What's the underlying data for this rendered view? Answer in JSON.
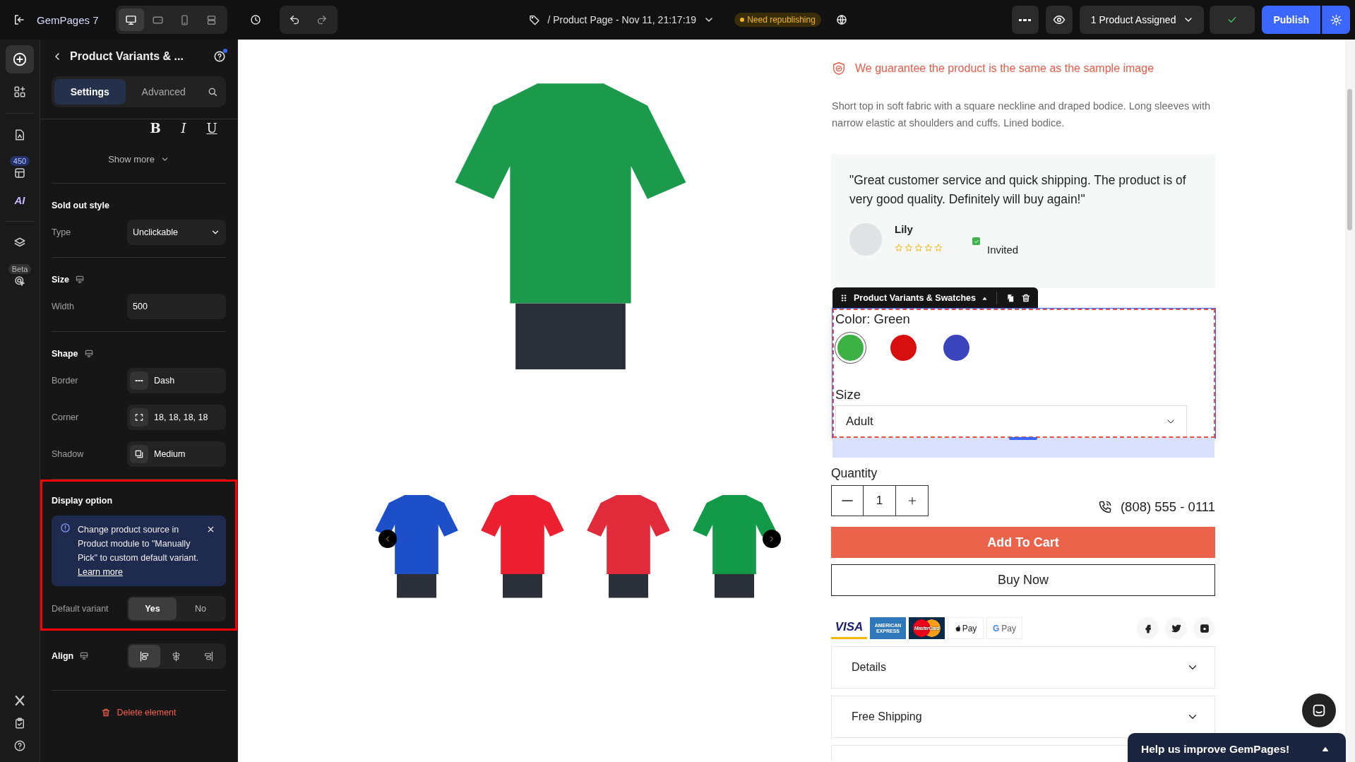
{
  "topbar": {
    "brand": "GemPages 7",
    "devices": [
      {
        "kind": "desktop",
        "selected": true
      },
      {
        "kind": "tablet",
        "selected": false
      },
      {
        "kind": "mobile",
        "selected": false
      },
      {
        "kind": "split",
        "selected": false
      }
    ],
    "page_title": "/ Product Page - Nov 11, 21:17:19",
    "status_badge": "Need republishing",
    "assigned": "1 Product Assigned",
    "publish": "Publish"
  },
  "rail": {
    "groups": [
      [
        {
          "kind": "add",
          "selected": true
        },
        {
          "kind": "elements",
          "selected": false
        }
      ],
      [
        {
          "kind": "pages",
          "selected": false
        },
        {
          "kind": "sections",
          "badge": "450",
          "selected": false
        },
        {
          "kind": "ai",
          "label": "AI",
          "selected": false
        }
      ],
      [
        {
          "kind": "layers",
          "selected": false
        },
        {
          "kind": "tracking",
          "badge": "Beta",
          "selected": false
        }
      ]
    ],
    "bottom": [
      {
        "kind": "x"
      },
      {
        "kind": "checklist"
      },
      {
        "kind": "help"
      }
    ]
  },
  "panel": {
    "title": "Product Variants & ...",
    "tabs": [
      {
        "label": "Settings",
        "selected": true
      },
      {
        "label": "Advanced",
        "selected": false
      }
    ],
    "format_buttons": [
      {
        "kind": "bold",
        "label": "B"
      },
      {
        "kind": "italic",
        "label": "I"
      },
      {
        "kind": "underline",
        "label": "U"
      }
    ],
    "show_more": "Show more",
    "sold_out": {
      "heading": "Sold out style",
      "type_label": "Type",
      "type_value": "Unclickable"
    },
    "size": {
      "heading": "Size",
      "width_label": "Width",
      "width_value": "500"
    },
    "shape": {
      "heading": "Shape",
      "rows": [
        {
          "kind": "border",
          "label": "Border",
          "value": "Dash"
        },
        {
          "kind": "corner",
          "label": "Corner",
          "value": "18, 18, 18, 18"
        },
        {
          "kind": "shadow",
          "label": "Shadow",
          "value": "Medium"
        }
      ]
    },
    "display_option": {
      "highlighted": true,
      "heading": "Display option",
      "notice": "Change product source in Product module to \"Manually Pick\" to custom default variant.",
      "notice_link": "Learn more",
      "default_variant_label": "Default variant",
      "options": [
        {
          "label": "Yes",
          "selected": true
        },
        {
          "label": "No",
          "selected": false
        }
      ]
    },
    "align": {
      "heading": "Align",
      "options": [
        {
          "kind": "left",
          "selected": true
        },
        {
          "kind": "center",
          "selected": false
        },
        {
          "kind": "right",
          "selected": false
        }
      ]
    },
    "delete": "Delete element"
  },
  "canvas": {
    "main_photo": {
      "color": "#1a9a4a"
    },
    "thumbnails": [
      {
        "color": "#1d4fc9"
      },
      {
        "color": "#ec2030"
      },
      {
        "color": "#e12a3a"
      },
      {
        "color": "#139a48"
      }
    ],
    "guarantee": "We guarantee the product is the same as the sample image",
    "description": "Short top in soft fabric with a square neckline and draped bodice. Long sleeves with narrow elastic at shoulders and cuffs. Lined bodice.",
    "review": {
      "quote": "\"Great customer service and quick shipping. The product is of very good quality. Definitely will buy again!\"",
      "name": "Lily",
      "stars": 0,
      "verified": true,
      "badge": "Invited"
    },
    "toolbar": "Product Variants & Swatches",
    "variants": {
      "selected": true,
      "color_label": "Color: Green",
      "swatches": [
        {
          "color": "#3cb043",
          "selected": true
        },
        {
          "color": "#d80f0f",
          "selected": false
        },
        {
          "color": "#3a45bd",
          "selected": false
        }
      ],
      "size_label": "Size",
      "size_value": "Adult"
    },
    "quantity": {
      "label": "Quantity",
      "value": "1"
    },
    "phone": "(808) 555 - 0111",
    "add_to_cart": "Add To Cart",
    "buy_now": "Buy Now",
    "payments": [
      {
        "kind": "visa",
        "label": "VISA"
      },
      {
        "kind": "amex",
        "label": "AMERICAN EXPRESS"
      },
      {
        "kind": "mastercard",
        "label": "MasterCard"
      },
      {
        "kind": "applepay",
        "label": "Pay"
      },
      {
        "kind": "googlepay",
        "mark": "G",
        "label": "Pay"
      }
    ],
    "socials": [
      {
        "kind": "facebook"
      },
      {
        "kind": "twitter"
      },
      {
        "kind": "instagram"
      }
    ],
    "accordions": [
      {
        "title": "Details",
        "expanded": false
      },
      {
        "title": "Free Shipping",
        "expanded": false
      }
    ],
    "help_banner": "Help us improve GemPages!"
  }
}
